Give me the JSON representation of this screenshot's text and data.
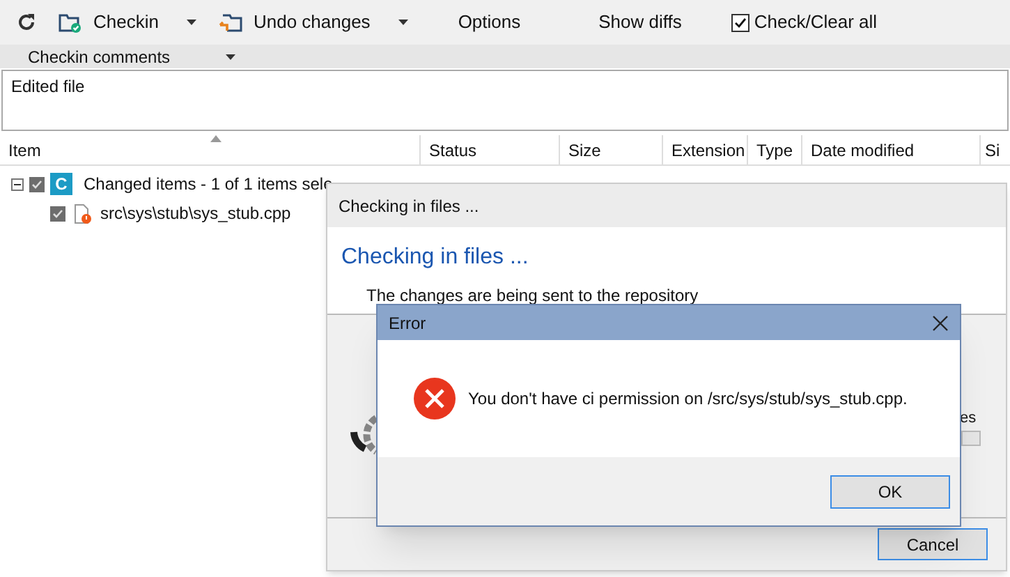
{
  "toolbar": {
    "items": [
      {
        "kind": "refresh"
      },
      {
        "kind": "checkin",
        "label": "Checkin"
      },
      {
        "kind": "undo",
        "label": "Undo changes"
      },
      {
        "kind": "text",
        "label": "Options"
      },
      {
        "kind": "text",
        "label": "Show diffs"
      },
      {
        "kind": "check",
        "label": "Check/Clear all",
        "checked": true
      }
    ]
  },
  "comments": {
    "label": "Checkin comments",
    "value": "Edited file"
  },
  "table": {
    "columns": [
      "Item",
      "Status",
      "Size",
      "Extension",
      "Type",
      "Date modified",
      "Si"
    ],
    "tree": [
      {
        "label": "Changed items - 1 of 1 items sele",
        "badge": "C",
        "expanded": true,
        "checked": true,
        "children": [
          {
            "label": "src\\sys\\stub\\sys_stub.cpp",
            "checked": true
          }
        ]
      }
    ]
  },
  "progress_dialog": {
    "title": "Checking in files ...",
    "heading": "Checking in files ...",
    "message": "The changes are being sent to the repository",
    "side_text": "es",
    "buttons": [
      "Cancel"
    ]
  },
  "error_dialog": {
    "title": "Error",
    "message": "You don't have ci permission on /src/sys/stub/sys_stub.cpp.",
    "buttons": [
      "OK"
    ]
  }
}
